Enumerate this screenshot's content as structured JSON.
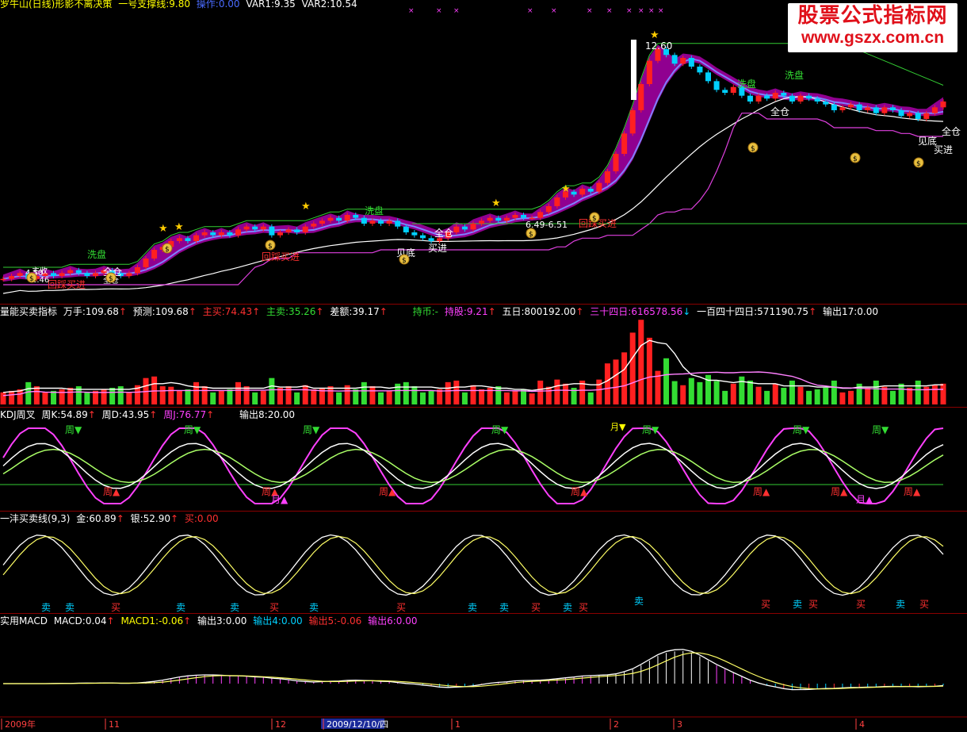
{
  "colors": {
    "up": "#ff2020",
    "down": "#00d0ff",
    "bg": "#000000",
    "sep": "#8a0000",
    "green": "#33dd33",
    "magenta": "#ff40ff",
    "yellow": "#ffff00",
    "white": "#ffffff",
    "ltblue": "#44aaff",
    "red": "#ff3030"
  },
  "panel1": {
    "title": "罗牛山(日线)形影不离决策",
    "support": "一号支撑线:9.80",
    "op": "操作:0.00",
    "var1": "VAR1:9.35",
    "var2": "VAR2:10.54"
  },
  "panel2": {
    "name": "量能买卖指标",
    "wanshou": "万手:109.68",
    "yuce": "预测:109.68",
    "zhumai": "主买:74.43",
    "zhumai2": "主卖:35.26",
    "chae": "差额:39.17",
    "chibi": "持币:-",
    "chigu": "持股:9.21",
    "wuri": "五日:800192.00",
    "sanshisi": "三十四日:616578.56",
    "yibai": "一百四十四日:571190.75",
    "shuchu": "输出17:0.00"
  },
  "panel3": {
    "name": "KDJ周叉",
    "k": "周K:54.89",
    "d": "周D:43.95",
    "j": "周J:76.77",
    "out": "输出8:20.00"
  },
  "panel4": {
    "name": "一沣买卖线(9,3)",
    "gold": "金:60.89",
    "silver": "银:52.90",
    "buy": "买:0.00"
  },
  "panel5": {
    "name": "实用MACD",
    "macd": "MACD:0.04",
    "macd1": "MACD1:-0.06",
    "o3": "输出3:0.00",
    "o4": "输出4:0.00",
    "o5": "输出5:-0.06",
    "o6": "输出6:0.00"
  },
  "watermark": {
    "cn": "股票公式指标网",
    "url": "www.gszx.com.cn"
  },
  "price_labels": {
    "high": "12.60",
    "xipan": [
      "洗盘",
      "洗盘",
      "洗盘",
      "洗盘"
    ],
    "quancang": [
      "全仓",
      "全仓",
      "全仓",
      "全仓"
    ],
    "jiandi": [
      "见底",
      "见底"
    ],
    "maijin": [
      "买进",
      "买进"
    ],
    "huitie": [
      "回踩买进",
      "回踩买进",
      "回踩买进"
    ],
    "range": "6.49-6.51",
    "misc_left": [
      "4.50",
      "1.46",
      "主收",
      "全仓"
    ]
  },
  "kdj_labels": {
    "zhou": "周",
    "yue": "月"
  },
  "yifeng_labels": {
    "mai": "卖",
    "buy": "买"
  },
  "time_axis": [
    "2009年",
    "11",
    "12",
    "2009/12/10/四",
    "1",
    "2",
    "3",
    "4"
  ],
  "chart_data": {
    "type": "candlestick",
    "y_range": [
      4.0,
      13.0
    ],
    "high_label": 12.6,
    "close_path": [
      4.5,
      4.6,
      4.7,
      4.5,
      4.6,
      4.7,
      4.6,
      4.7,
      4.8,
      4.7,
      4.6,
      4.7,
      4.8,
      4.7,
      4.6,
      4.7,
      4.9,
      5.2,
      5.5,
      5.6,
      5.8,
      5.9,
      5.8,
      6.0,
      6.1,
      6.0,
      6.1,
      6.0,
      6.2,
      6.3,
      6.2,
      6.3,
      6.0,
      6.1,
      6.2,
      6.1,
      6.3,
      6.4,
      6.5,
      6.6,
      6.5,
      6.7,
      6.6,
      6.4,
      6.5,
      6.4,
      6.5,
      6.3,
      6.1,
      6.0,
      5.9,
      5.8,
      5.9,
      6.1,
      6.3,
      6.2,
      6.4,
      6.5,
      6.6,
      6.5,
      6.6,
      6.7,
      6.6,
      6.6,
      6.8,
      7.0,
      7.3,
      7.5,
      7.4,
      7.6,
      7.5,
      7.8,
      8.2,
      8.8,
      9.5,
      10.3,
      11.2,
      12.0,
      12.4,
      12.2,
      11.9,
      12.1,
      11.8,
      11.6,
      11.3,
      11.0,
      10.9,
      11.1,
      10.8,
      10.6,
      10.8,
      10.7,
      10.9,
      10.8,
      10.6,
      10.8,
      10.7,
      10.6,
      10.5,
      10.3,
      10.4,
      10.5,
      10.3,
      10.4,
      10.2,
      10.4,
      10.3,
      10.1,
      10.2,
      10.0,
      10.2,
      10.4,
      10.6
    ]
  }
}
